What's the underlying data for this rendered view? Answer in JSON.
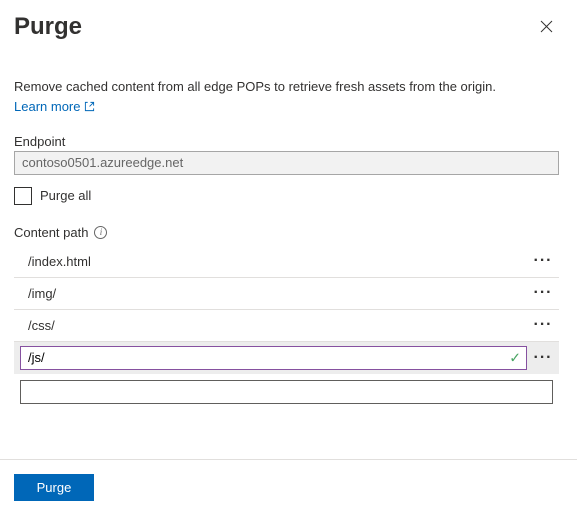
{
  "header": {
    "title": "Purge",
    "close_aria": "Close"
  },
  "description": "Remove cached content from all edge POPs to retrieve fresh assets from the origin.",
  "learn_more": "Learn more",
  "endpoint": {
    "label": "Endpoint",
    "value": "contoso0501.azureedge.net"
  },
  "purge_all": {
    "label": "Purge all",
    "checked": false
  },
  "content_path": {
    "label": "Content path",
    "rows": [
      {
        "value": "/index.html"
      },
      {
        "value": "/img/"
      },
      {
        "value": "/css/"
      }
    ],
    "editing": {
      "value": "/js/",
      "valid": true
    },
    "blank": {
      "value": ""
    }
  },
  "footer": {
    "purge_button": "Purge"
  }
}
